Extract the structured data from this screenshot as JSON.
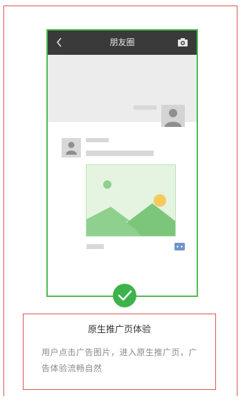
{
  "phone": {
    "header_title": "朋友圈",
    "back_icon": "chevron-left-icon",
    "camera_icon": "camera-icon",
    "comment_icon": "comment-icon"
  },
  "badge": {
    "icon": "check-circle-icon",
    "color": "#3cb44b"
  },
  "feature": {
    "title": "原生推广页体验",
    "description": "用户点击广告图片，进入原生推广页，广告体验流畅自然"
  },
  "colors": {
    "frame_border": "#d9534f",
    "phone_border": "#4cbb4c",
    "header_bg": "#3a3a3a",
    "image_bg": "#e4f4e0",
    "sun": "#f6c95a",
    "mountain": "#8fd08f"
  }
}
